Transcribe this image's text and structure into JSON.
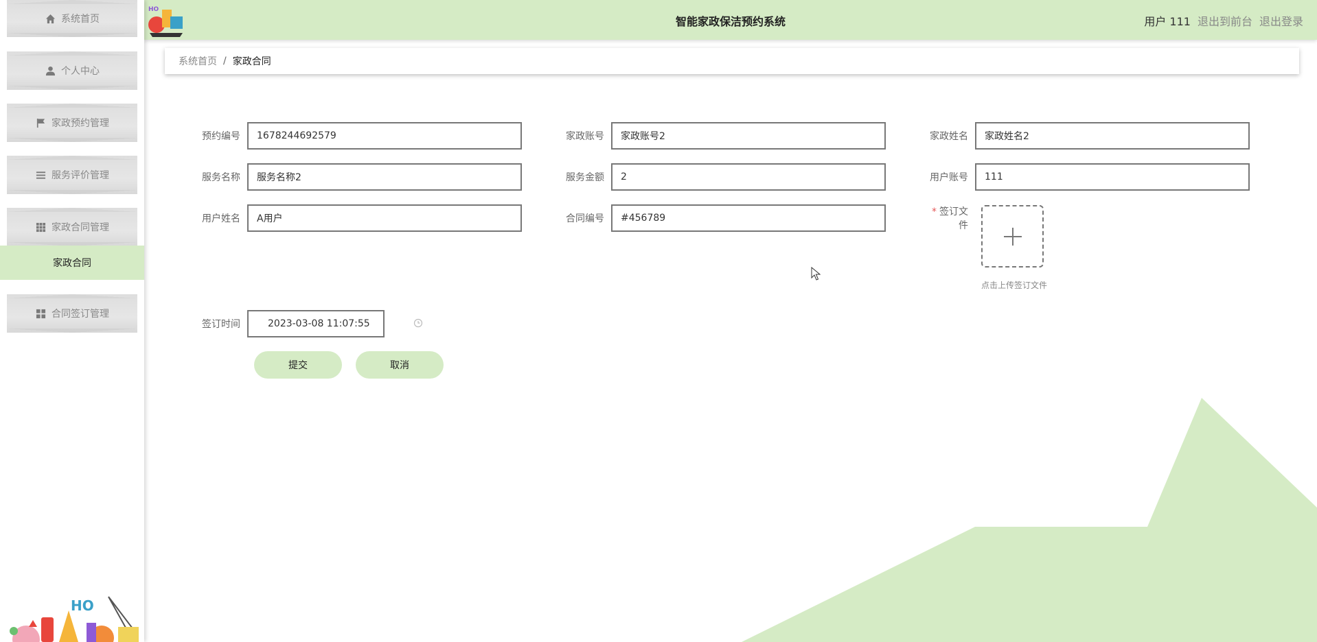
{
  "sidebar": {
    "items": [
      {
        "label": "系统首页",
        "icon": "home-icon"
      },
      {
        "label": "个人中心",
        "icon": "user-icon"
      },
      {
        "label": "家政预约管理",
        "icon": "flag-icon"
      },
      {
        "label": "服务评价管理",
        "icon": "list-icon"
      },
      {
        "label": "家政合同管理",
        "icon": "grid-icon"
      },
      {
        "label": "合同签订管理",
        "icon": "apps-icon"
      }
    ],
    "active_sub": "家政合同"
  },
  "header": {
    "title": "智能家政保洁预约系统",
    "user": "用户 111",
    "front_link": "退出到前台",
    "logout_link": "退出登录"
  },
  "breadcrumb": {
    "home": "系统首页",
    "separator": "/",
    "current": "家政合同"
  },
  "form": {
    "booking_no": {
      "label": "预约编号",
      "value": "1678244692579"
    },
    "housekeeper_account": {
      "label": "家政账号",
      "value": "家政账号2"
    },
    "housekeeper_name": {
      "label": "家政姓名",
      "value": "家政姓名2"
    },
    "service_name": {
      "label": "服务名称",
      "value": "服务名称2"
    },
    "service_amount": {
      "label": "服务金额",
      "value": "2"
    },
    "user_account": {
      "label": "用户账号",
      "value": "111"
    },
    "user_name": {
      "label": "用户姓名",
      "value": "A用户"
    },
    "contract_no": {
      "label": "合同编号",
      "value": "#456789"
    },
    "sign_file": {
      "label": "签订文件",
      "required_mark": "*",
      "hint": "点击上传签订文件"
    },
    "sign_time": {
      "label": "签订时间",
      "value": "2023-03-08 11:07:55"
    },
    "submit": "提交",
    "cancel": "取消"
  },
  "colors": {
    "accent": "#d5ebc5",
    "menu_bg": "#e0e0e0",
    "required": "#e45656"
  }
}
